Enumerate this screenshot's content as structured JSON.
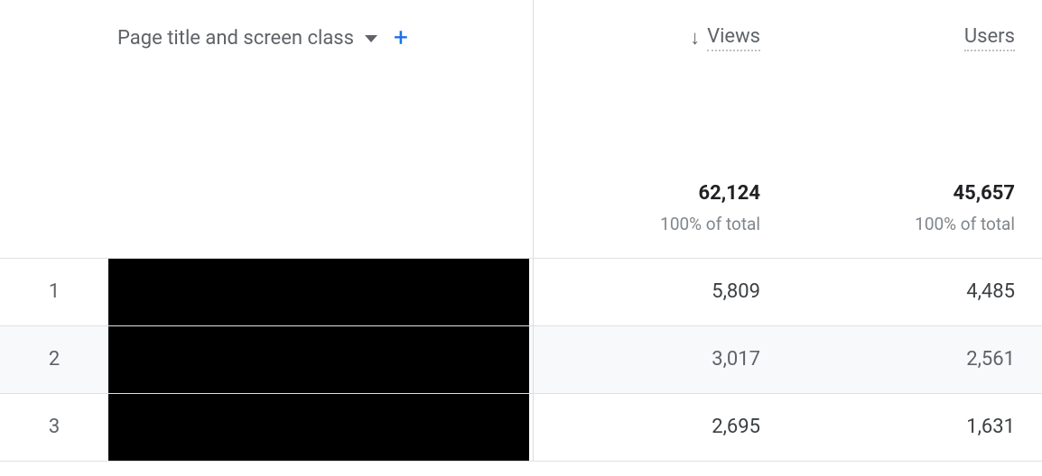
{
  "dimension": {
    "label": "Page title and screen class"
  },
  "metrics": [
    {
      "label": "Views",
      "sorted": true,
      "total": "62,124",
      "totalPct": "100% of total"
    },
    {
      "label": "Users",
      "sorted": false,
      "total": "45,657",
      "totalPct": "100% of total"
    }
  ],
  "rows": [
    {
      "index": "1",
      "values": [
        "5,809",
        "4,485"
      ]
    },
    {
      "index": "2",
      "values": [
        "3,017",
        "2,561"
      ]
    },
    {
      "index": "3",
      "values": [
        "2,695",
        "1,631"
      ]
    }
  ],
  "chart_data": {
    "type": "table",
    "title": "Page title and screen class",
    "columns": [
      "Views",
      "Users"
    ],
    "totals": [
      62124,
      45657
    ],
    "rows": [
      {
        "index": 1,
        "views": 5809,
        "users": 4485
      },
      {
        "index": 2,
        "views": 3017,
        "users": 2561
      },
      {
        "index": 3,
        "views": 2695,
        "users": 1631
      }
    ]
  }
}
